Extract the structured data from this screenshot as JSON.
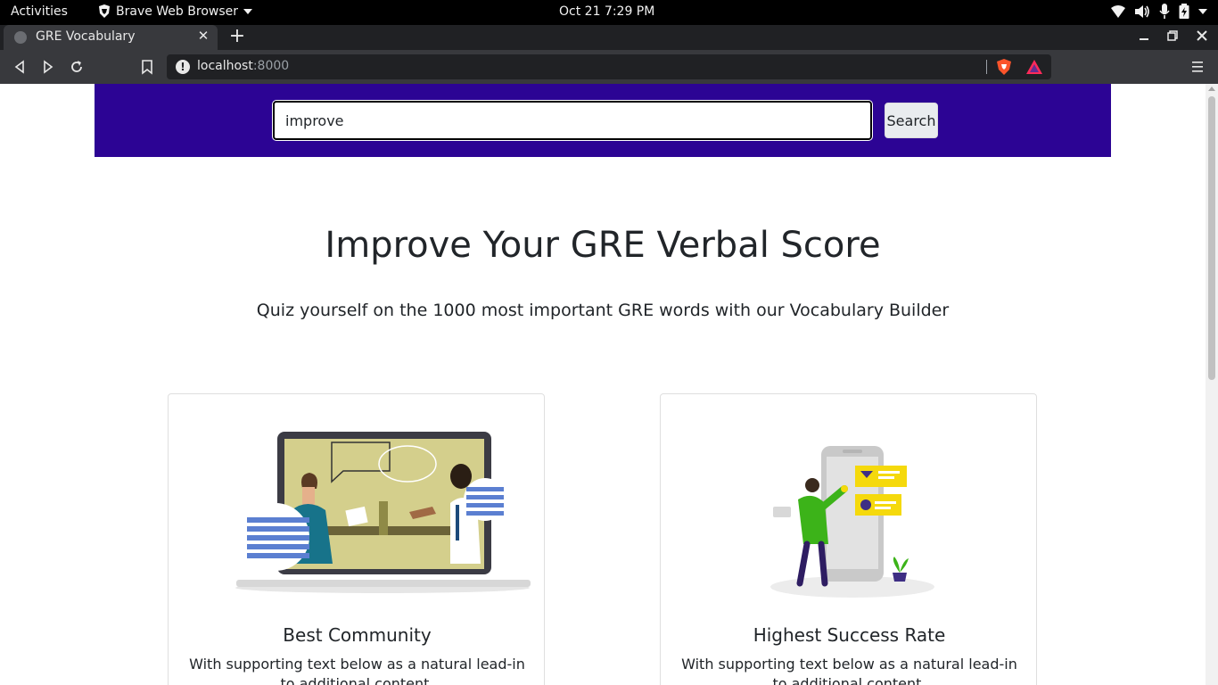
{
  "system_bar": {
    "activities": "Activities",
    "app_name": "Brave Web Browser",
    "clock": "Oct 21   7:29 PM"
  },
  "browser": {
    "tab_title": "GRE Vocabulary",
    "url_host": "localhost",
    "url_port": ":8000"
  },
  "search": {
    "value": "improve",
    "button_label": "Search"
  },
  "hero": {
    "headline": "Improve Your GRE Verbal Score",
    "subline": "Quiz yourself on the 1000 most important GRE words with our Vocabulary Builder"
  },
  "cards": [
    {
      "title": "Best Community",
      "text": "With supporting text below as a natural lead-in to additional content."
    },
    {
      "title": "Highest Success Rate",
      "text": "With supporting text below as a natural lead-in to additional content."
    }
  ],
  "colors": {
    "hero_band": "#2c0494",
    "chrome_dark": "#202124",
    "chrome_mid": "#38393d"
  }
}
